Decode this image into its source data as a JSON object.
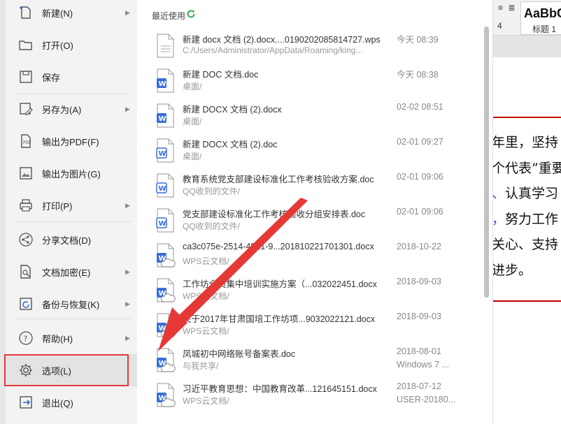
{
  "menu": {
    "items": [
      {
        "label": "新建(N)",
        "has_arrow": true,
        "icon": "new-doc-icon"
      },
      {
        "label": "打开(O)",
        "has_arrow": false,
        "icon": "folder-open-icon"
      },
      {
        "label": "保存",
        "has_arrow": false,
        "icon": "save-icon"
      },
      {
        "label": "另存为(A)",
        "has_arrow": true,
        "icon": "save-as-icon"
      },
      {
        "label": "输出为PDF(F)",
        "has_arrow": false,
        "icon": "pdf-export-icon"
      },
      {
        "label": "输出为图片(G)",
        "has_arrow": false,
        "icon": "image-export-icon"
      },
      {
        "label": "打印(P)",
        "has_arrow": true,
        "icon": "printer-icon"
      },
      {
        "label": "分享文档(D)",
        "has_arrow": false,
        "icon": "share-icon"
      },
      {
        "label": "文档加密(E)",
        "has_arrow": true,
        "icon": "lock-doc-icon"
      },
      {
        "label": "备份与恢复(K)",
        "has_arrow": true,
        "icon": "backup-icon"
      },
      {
        "label": "帮助(H)",
        "has_arrow": true,
        "icon": "help-icon"
      },
      {
        "label": "选项(L)",
        "has_arrow": false,
        "icon": "gear-icon"
      },
      {
        "label": "退出(Q)",
        "has_arrow": false,
        "icon": "exit-icon"
      }
    ]
  },
  "recent": {
    "title": "最近使用",
    "files": [
      {
        "name": "新建 docx 文档 (2).docx....0190202085814727.wps",
        "path": "C:/Users/Administrator/AppData/Roaming/king...",
        "date": "今天 08:39",
        "user": "",
        "type": "wps"
      },
      {
        "name": "新建 DOC 文档.doc",
        "path": "桌面/",
        "date": "今天 08:38",
        "user": "",
        "type": "word"
      },
      {
        "name": "新建 DOCX 文档 (2).docx",
        "path": "桌面/",
        "date": "02-02 08:51",
        "user": "",
        "type": "word"
      },
      {
        "name": "新建 DOCX 文档 (2).doc",
        "path": "桌面/",
        "date": "02-01 09:27",
        "user": "",
        "type": "word-outline"
      },
      {
        "name": "教育系统党支部建设标准化工作考核验收方案.doc",
        "path": "QQ收到的文件/",
        "date": "02-01 09:06",
        "user": "",
        "type": "word-outline"
      },
      {
        "name": "党支部建设标准化工作考核验收分组安排表.doc",
        "path": "QQ收到的文件/",
        "date": "02-01 09:06",
        "user": "",
        "type": "word-outline"
      },
      {
        "name": "ca3c075e-2514-4821-9...201810221701301.docx",
        "path": "WPS云文档/",
        "date": "2018-10-22",
        "user": "",
        "type": "word-cloud"
      },
      {
        "name": "工作坊全员集中培训实施方案（...032022451.docx",
        "path": "WPS云文档/",
        "date": "2018-09-03",
        "user": "",
        "type": "word-cloud"
      },
      {
        "name": "关于2017年甘肃国培工作坊项...9032022121.docx",
        "path": "WPS云文档/",
        "date": "2018-09-03",
        "user": "",
        "type": "word-cloud"
      },
      {
        "name": "凤城初中网络账号备案表.doc",
        "path": "与我共享/",
        "date": "2018-08-01",
        "user": "Windows 7 ...",
        "type": "word-cloud"
      },
      {
        "name": "习近平教育思想：中国教育改革...121645151.docx",
        "path": "WPS云文档/",
        "date": "2018-07-12",
        "user": "USER-20180...",
        "type": "word-cloud"
      }
    ]
  },
  "document": {
    "ribbon_style_sample": "AaBbC",
    "ribbon_style_name": "标题 1",
    "ribbon_num": "4",
    "lines": [
      "年里，坚持",
      "个代表”重要",
      "、认真学习",
      "，努力工作",
      "关心、支持",
      "进步。"
    ]
  },
  "colors": {
    "highlight": "#e03a3a",
    "word_blue": "#3a6fd8",
    "refresh_green": "#3aa856"
  }
}
